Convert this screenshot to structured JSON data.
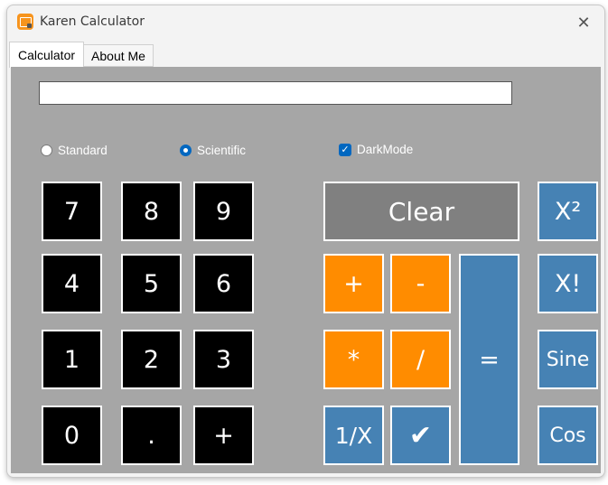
{
  "window": {
    "title": "Karen Calculator",
    "close_glyph": "✕"
  },
  "tabs": [
    {
      "label": "Calculator"
    },
    {
      "label": "About  Me"
    }
  ],
  "display": {
    "value": ""
  },
  "options": {
    "standard": "Standard",
    "scientific": "Scientific",
    "darkmode": "DarkMode",
    "darkmode_check": "✓",
    "selected_mode": "Scientific",
    "darkmode_checked": true
  },
  "keys": {
    "seven": "7",
    "eight": "8",
    "nine": "9",
    "four": "4",
    "five": "5",
    "six": "6",
    "one": "1",
    "two": "2",
    "three": "3",
    "zero": "0",
    "dot": ".",
    "plus_num": "+",
    "clear": "Clear",
    "plus": "+",
    "minus": "-",
    "multiply": "*",
    "divide": "/",
    "reciprocal": "1/X",
    "check": "✔",
    "equals": "=",
    "square": "X²",
    "factorial": "X!",
    "sine": "Sine",
    "cos": "Cos"
  },
  "colors": {
    "number_key": "#000000",
    "clear_key": "#808080",
    "operator_key": "#ff8c00",
    "function_key": "#4682b4",
    "panel": "#a6a6a6",
    "accent": "#0067c0"
  },
  "icons": {
    "app": "calculator-app-icon",
    "close": "close-icon",
    "check": "checkmark-icon"
  }
}
